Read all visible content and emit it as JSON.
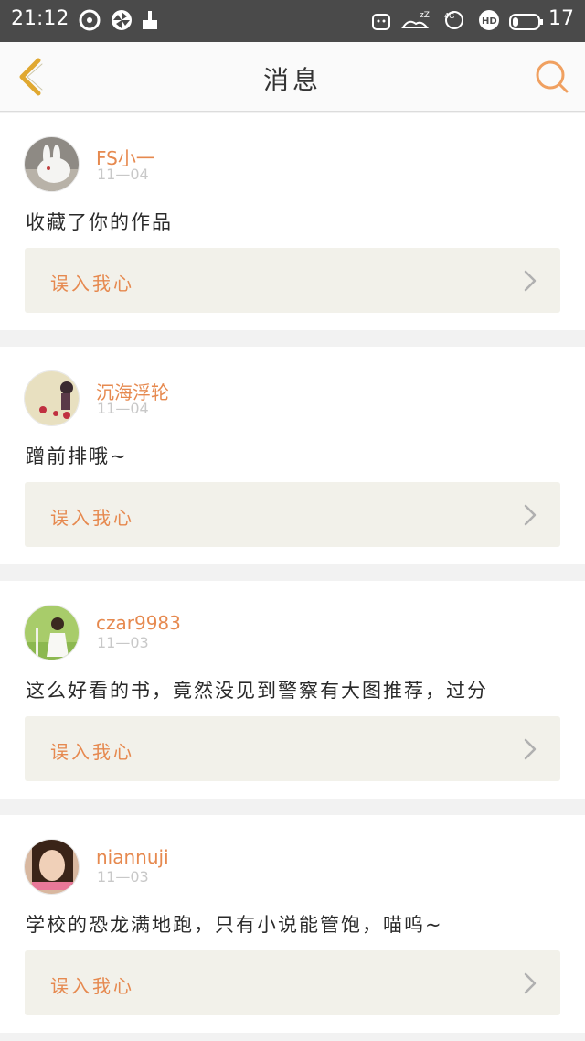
{
  "status_bar": {
    "time": "21:12",
    "battery_level": "17",
    "icons": [
      "sync-icon",
      "pinwheel-icon",
      "cleaner-icon",
      "android-icon",
      "sleep-icon",
      "network-4g-icon",
      "hd-icon",
      "battery-icon"
    ]
  },
  "nav": {
    "title": "消息",
    "back_icon": "chevron-left-icon",
    "search_icon": "search-icon",
    "accent_color": "#e6894f"
  },
  "messages": [
    {
      "username": "FS小一",
      "date": "11—04",
      "text": "收藏了你的作品",
      "work_title": "误入我心",
      "avatar": "white-rabbit"
    },
    {
      "username": "沉海浮轮",
      "date": "11—04",
      "text": "蹭前排哦~",
      "work_title": "误入我心",
      "avatar": "cartoon-lady"
    },
    {
      "username": "czar9983",
      "date": "11—03",
      "text": "这么好看的书，竟然没见到警察有大图推荐，过分",
      "work_title": "误入我心",
      "avatar": "girl-in-green"
    },
    {
      "username": "niannuji",
      "date": "11—03",
      "text": "学校的恐龙满地跑，只有小说能管饱，喵呜~",
      "work_title": "误入我心",
      "avatar": "girl-peace-sign"
    }
  ]
}
